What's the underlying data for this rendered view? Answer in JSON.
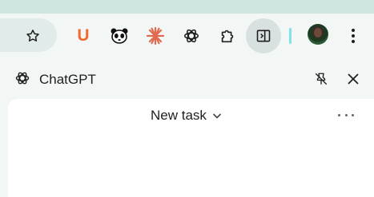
{
  "toolbar": {
    "icons": [
      {
        "name": "bookmark-star-icon"
      },
      {
        "name": "extension-u-icon",
        "label": "U",
        "color": "#f26b2e"
      },
      {
        "name": "panda-extension-icon"
      },
      {
        "name": "claude-extension-icon",
        "color": "#e06a4d"
      },
      {
        "name": "openai-extension-icon"
      },
      {
        "name": "extensions-puzzle-icon"
      },
      {
        "name": "side-panel-icon"
      },
      {
        "name": "profile-avatar"
      },
      {
        "name": "browser-menu-icon"
      }
    ],
    "accent_separator_color": "#7fe3ea"
  },
  "side_panel": {
    "title": "ChatGPT",
    "unpin_icon": "unpin-icon",
    "close_icon": "close-icon"
  },
  "content": {
    "task_title": "New task",
    "more_icon": "more-horizontal-icon"
  }
}
